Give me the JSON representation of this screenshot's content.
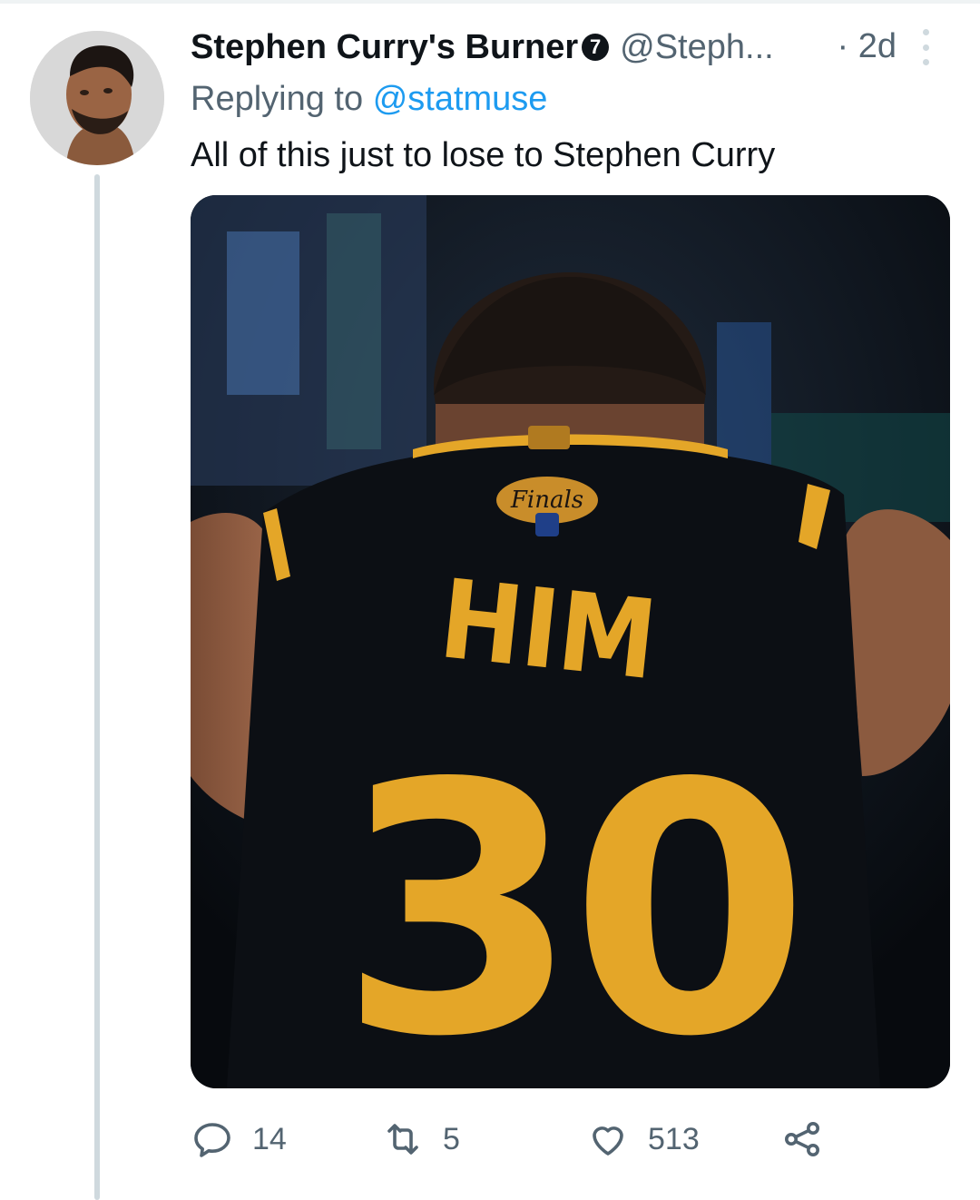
{
  "tweet": {
    "author_name": "Stephen Curry's Burner",
    "badge_glyph": "7",
    "handle": "@Steph...",
    "time": "· 2d",
    "replying_prefix": "Replying to",
    "replying_to": "@statmuse",
    "text": "All of this just to lose to Stephen Curry",
    "media": {
      "jersey_patch": "Finals",
      "jersey_name": "HIM",
      "jersey_number": "30"
    }
  },
  "actions": {
    "replies": "14",
    "retweets": "5",
    "likes": "513"
  },
  "icons": {
    "reply": "reply-icon",
    "retweet": "retweet-icon",
    "like": "heart-icon",
    "share": "share-icon",
    "more": "more-vertical-icon"
  },
  "colors": {
    "link": "#1d9bf0",
    "muted": "#536471",
    "text": "#0f1419",
    "jersey_gold": "#e4a628",
    "jersey_black": "#0c0f14"
  }
}
